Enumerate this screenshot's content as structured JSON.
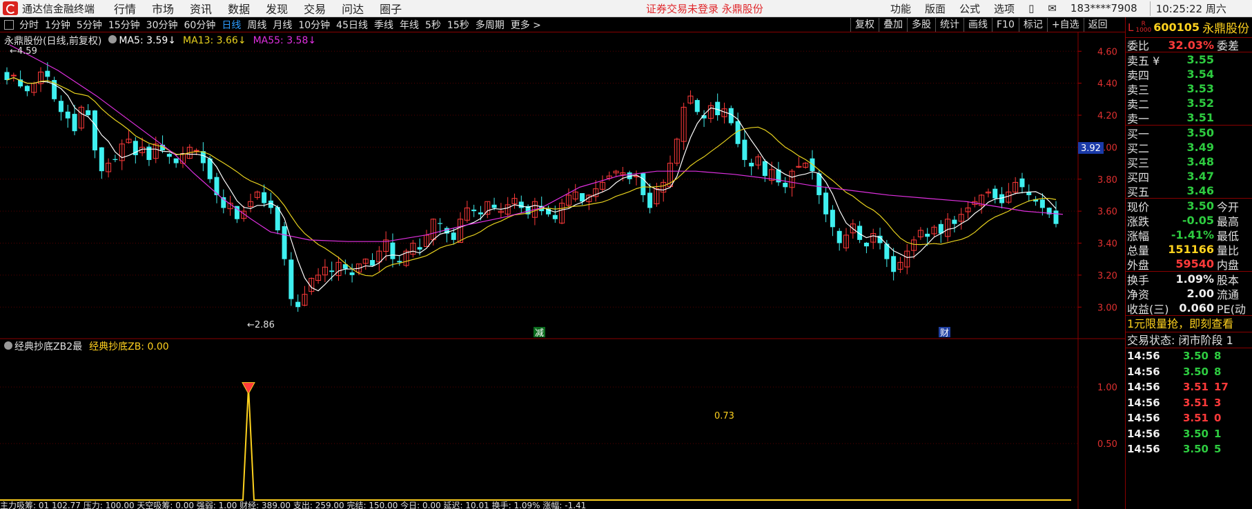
{
  "titlebar": {
    "app_name": "通达信金融终端",
    "menu": [
      "行情",
      "市场",
      "资讯",
      "数据",
      "发现",
      "交易",
      "问达",
      "圈子"
    ],
    "warning": "证券交易未登录  永鼎股份",
    "right_menu": [
      "功能",
      "版面",
      "公式",
      "选项"
    ],
    "user": "183****7908",
    "clock": "10:25:22 周六"
  },
  "periodbar": {
    "periods": [
      "分时",
      "1分钟",
      "5分钟",
      "15分钟",
      "30分钟",
      "60分钟",
      "日线",
      "周线",
      "月线",
      "10分钟",
      "45日线",
      "季线",
      "年线",
      "5秒",
      "15秒",
      "多周期",
      "更多 >"
    ],
    "active": "日线",
    "tools": [
      "复权",
      "叠加",
      "多股",
      "统计",
      "画线",
      "F10",
      "标记",
      "+自选",
      "返回"
    ]
  },
  "main_legend": {
    "title": "永鼎股份(日线,前复权)",
    "ma5": "MA5: 3.59↓",
    "ma13": "MA13: 3.66↓",
    "ma55": "MA55: 3.58↓",
    "colors": {
      "ma5": "#ffffff",
      "ma13": "#e8d21e",
      "ma55": "#e030e0"
    }
  },
  "annotations": {
    "high": "4.59",
    "low": "2.86",
    "price_tag": "3.92",
    "marker_1": "减",
    "marker_2": "财"
  },
  "sub_legend": {
    "title": "经典抄底ZB2最",
    "value": "经典抄底ZB: 0.00",
    "label_073": "0.73"
  },
  "bottom_legend": "主力吸筹: 01  102.77   压力: 100.00   天空吸筹: 0.00   强弱: 1.00   财经: 389.00   支出: 259.00   完结: 150.00   今日: 0.00   延迟: 10.01   换手: 1.09%   涨幅: -1.41",
  "panel": {
    "badge_l": "L",
    "badge_r": "R",
    "badge_num": "1000",
    "code": "600105",
    "name": "永鼎股份",
    "weibi": {
      "label": "委比",
      "value": "32.03%",
      "right": "委差"
    },
    "sells": [
      {
        "label": "卖五 ¥",
        "price": "3.55"
      },
      {
        "label": "卖四",
        "price": "3.54"
      },
      {
        "label": "卖三",
        "price": "3.53"
      },
      {
        "label": "卖二",
        "price": "3.52"
      },
      {
        "label": "卖一",
        "price": "3.51"
      }
    ],
    "buys": [
      {
        "label": "买一",
        "price": "3.50"
      },
      {
        "label": "买二",
        "price": "3.49"
      },
      {
        "label": "买三",
        "price": "3.48"
      },
      {
        "label": "买四",
        "price": "3.47"
      },
      {
        "label": "买五",
        "price": "3.46"
      }
    ],
    "quote": [
      {
        "label": "现价",
        "value": "3.50",
        "right": "今开",
        "color": "green"
      },
      {
        "label": "涨跌",
        "value": "-0.05",
        "right": "最高",
        "color": "green"
      },
      {
        "label": "涨幅",
        "value": "-1.41%",
        "right": "最低",
        "color": "green"
      },
      {
        "label": "总量",
        "value": "151166",
        "right": "量比",
        "color": "yellow"
      },
      {
        "label": "外盘",
        "value": "59540",
        "right": "内盘",
        "color": "red"
      }
    ],
    "fund": [
      {
        "label": "换手",
        "value": "1.09%",
        "right": "股本"
      },
      {
        "label": "净资",
        "value": "2.00",
        "right": "流通"
      },
      {
        "label": "收益(三)",
        "value": "0.060",
        "right": "PE(动"
      }
    ],
    "promo": "1元限量抢，即刻查看",
    "trade_state": "交易状态: 闭市阶段 1",
    "ticks": [
      {
        "time": "14:56",
        "price": "3.50",
        "vol": "8",
        "color": "green"
      },
      {
        "time": "14:56",
        "price": "3.50",
        "vol": "8",
        "color": "green"
      },
      {
        "time": "14:56",
        "price": "3.51",
        "vol": "17",
        "color": "red"
      },
      {
        "time": "14:56",
        "price": "3.51",
        "vol": "3",
        "color": "red"
      },
      {
        "time": "14:56",
        "price": "3.51",
        "vol": "0",
        "color": "red"
      },
      {
        "time": "14:56",
        "price": "3.50",
        "vol": "1",
        "color": "green"
      },
      {
        "time": "14:56",
        "price": "3.50",
        "vol": "5",
        "color": "green"
      }
    ]
  },
  "chart_data": {
    "type": "candlestick",
    "price_axis": {
      "ticks": [
        "4.60",
        "4.40",
        "4.20",
        "4.00",
        "3.80",
        "3.60",
        "3.40",
        "3.20",
        "3.00"
      ],
      "range": [
        2.82,
        4.64
      ]
    },
    "sub_axis": {
      "ticks": [
        "1.00",
        "0.50"
      ],
      "range": [
        0,
        1.3
      ]
    },
    "ma55_points": [
      [
        10,
        4.64
      ],
      [
        60,
        4.48
      ],
      [
        100,
        4.32
      ],
      [
        140,
        4.14
      ],
      [
        180,
        3.96
      ],
      [
        200,
        3.84
      ],
      [
        230,
        3.68
      ],
      [
        260,
        3.55
      ],
      [
        280,
        3.47
      ],
      [
        320,
        3.42
      ],
      [
        360,
        3.41
      ],
      [
        400,
        3.41
      ],
      [
        440,
        3.45
      ],
      [
        480,
        3.51
      ],
      [
        520,
        3.56
      ],
      [
        560,
        3.62
      ],
      [
        600,
        3.75
      ],
      [
        640,
        3.82
      ],
      [
        680,
        3.85
      ],
      [
        720,
        3.85
      ],
      [
        760,
        3.83
      ],
      [
        800,
        3.8
      ],
      [
        840,
        3.76
      ],
      [
        880,
        3.73
      ],
      [
        920,
        3.7
      ],
      [
        960,
        3.68
      ],
      [
        1000,
        3.66
      ],
      [
        1040,
        3.62
      ],
      [
        1060,
        3.6
      ],
      [
        1080,
        3.59
      ],
      [
        1100,
        3.58
      ]
    ],
    "closes": [
      4.42,
      4.45,
      4.38,
      4.35,
      4.4,
      4.47,
      4.44,
      4.3,
      4.22,
      4.18,
      4.1,
      4.25,
      4.2,
      3.98,
      3.85,
      3.9,
      3.92,
      4.02,
      4.05,
      3.95,
      4.0,
      3.92,
      4.02,
      3.98,
      3.94,
      3.9,
      3.96,
      4.0,
      3.98,
      3.9,
      3.8,
      3.7,
      3.62,
      3.65,
      3.55,
      3.6,
      3.66,
      3.72,
      3.65,
      3.62,
      3.48,
      3.3,
      3.05,
      3.0,
      3.08,
      3.18,
      3.2,
      3.25,
      3.22,
      3.28,
      3.24,
      3.2,
      3.27,
      3.3,
      3.26,
      3.35,
      3.42,
      3.3,
      3.28,
      3.35,
      3.4,
      3.36,
      3.45,
      3.55,
      3.52,
      3.46,
      3.42,
      3.55,
      3.62,
      3.6,
      3.58,
      3.66,
      3.62,
      3.6,
      3.64,
      3.68,
      3.62,
      3.58,
      3.66,
      3.6,
      3.58,
      3.55,
      3.65,
      3.7,
      3.72,
      3.66,
      3.7,
      3.74,
      3.78,
      3.82,
      3.85,
      3.84,
      3.8,
      3.82,
      3.7,
      3.62,
      3.74,
      3.78,
      3.9,
      4.05,
      4.25,
      4.32,
      4.22,
      4.18,
      4.26,
      4.2,
      4.24,
      4.15,
      4.02,
      3.92,
      3.88,
      3.94,
      3.82,
      3.86,
      3.78,
      3.75,
      3.85,
      3.88,
      3.9,
      3.85,
      3.7,
      3.58,
      3.5,
      3.4,
      3.45,
      3.52,
      3.42,
      3.38,
      3.46,
      3.4,
      3.3,
      3.22,
      3.28,
      3.35,
      3.42,
      3.48,
      3.44,
      3.5,
      3.46,
      3.55,
      3.52,
      3.58,
      3.62,
      3.66,
      3.7,
      3.72,
      3.68,
      3.65,
      3.72,
      3.78,
      3.75,
      3.7,
      3.66,
      3.62,
      3.58,
      3.52
    ],
    "signal": {
      "peak_value": 1.0,
      "label": "0.73"
    }
  }
}
